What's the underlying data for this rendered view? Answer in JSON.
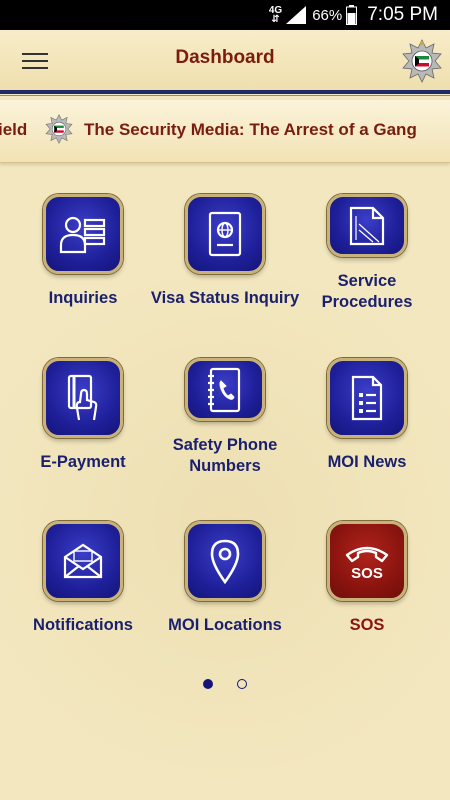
{
  "status_bar": {
    "network": "4G",
    "battery_percent": "66%",
    "time": "7:05 PM",
    "icons": [
      "signal-icon",
      "battery-icon"
    ]
  },
  "header": {
    "title": "Dashboard",
    "menu_icon": "hamburger-menu-icon",
    "emblem_icon": "kuwait-police-emblem-icon"
  },
  "ticker": {
    "previous_text": "ield",
    "headline": "The Security Media: The Arrest of a Gang"
  },
  "tiles": [
    {
      "label": "Inquiries",
      "icon": "user-list-icon"
    },
    {
      "label": "Visa Status Inquiry",
      "icon": "passport-icon"
    },
    {
      "label": "Service Procedures",
      "icon": "document-folder-icon"
    },
    {
      "label": "E-Payment",
      "icon": "card-hand-icon"
    },
    {
      "label": "Safety Phone Numbers",
      "icon": "phone-book-icon"
    },
    {
      "label": "MOI News",
      "icon": "news-document-icon"
    },
    {
      "label": "Notifications",
      "icon": "envelope-icon"
    },
    {
      "label": "MOI Locations",
      "icon": "map-pin-icon"
    },
    {
      "label": "SOS",
      "icon": "sos-phone-icon",
      "sos_badge": "SOS"
    }
  ],
  "pager": {
    "pages": 2,
    "current": 1
  },
  "colors": {
    "brand_blue": "#1f209a",
    "title_red": "#7a1d0e",
    "sos_red": "#8b140f",
    "background": "#f3e7bf"
  }
}
